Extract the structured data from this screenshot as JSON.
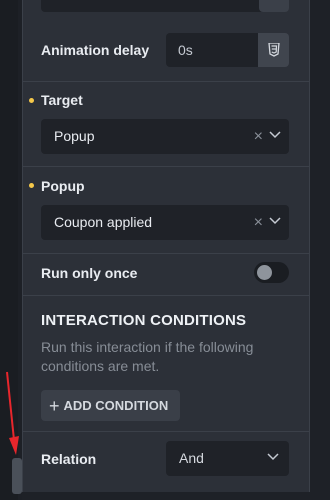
{
  "animation_delay": {
    "label": "Animation delay",
    "value": "0s",
    "unit_button_icon": "css3-icon"
  },
  "target": {
    "label": "Target",
    "value": "Popup"
  },
  "popup": {
    "label": "Popup",
    "value": "Coupon applied"
  },
  "run_only_once": {
    "label": "Run only once",
    "enabled": false
  },
  "conditions": {
    "title": "INTERACTION CONDITIONS",
    "description": "Run this interaction if the following conditions are met.",
    "add_button": "ADD CONDITION"
  },
  "relation": {
    "label": "Relation",
    "value": "And"
  },
  "colors": {
    "required_dot": "#f5c84a",
    "annotation_arrow": "#e8262c",
    "panel_bg": "#2c3038"
  }
}
